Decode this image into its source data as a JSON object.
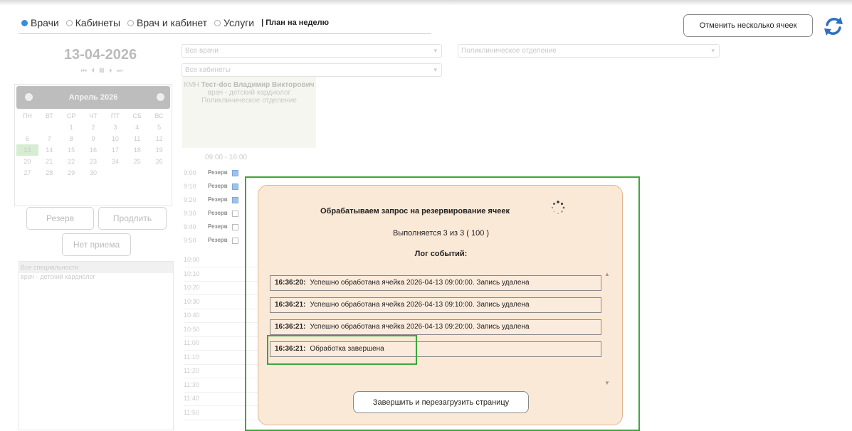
{
  "header": {
    "radio_options": [
      {
        "label": "Врачи",
        "selected": true
      },
      {
        "label": "Кабинеты",
        "selected": false
      },
      {
        "label": "Врач и кабинет",
        "selected": false
      },
      {
        "label": "Услуги",
        "selected": false
      }
    ],
    "plan_label": "| План на неделю",
    "cancel_button": "Отменить несколько ячеек",
    "refresh_icon": "refresh-icon"
  },
  "left": {
    "date": "13-04-2026",
    "nav": "⏮ ⏴ ▦ ⏵ ⏭",
    "calendar": {
      "month": "Апрель 2026",
      "weekdays": [
        "ПН",
        "ВТ",
        "СР",
        "ЧТ",
        "ПТ",
        "СБ",
        "ВС"
      ],
      "days": [
        "",
        "",
        "1",
        "2",
        "3",
        "4",
        "5",
        "6",
        "7",
        "8",
        "9",
        "10",
        "11",
        "12",
        "13",
        "14",
        "15",
        "16",
        "17",
        "18",
        "19",
        "20",
        "21",
        "22",
        "23",
        "24",
        "25",
        "26",
        "27",
        "28",
        "29",
        "30",
        "",
        "",
        ""
      ],
      "today": "13"
    },
    "buttons": {
      "reserve": "Резерв",
      "extend": "Продлить",
      "no_reception": "Нет приема"
    },
    "specialties": [
      "Все специальности",
      "врач - детский кардиолог"
    ]
  },
  "filters": {
    "doctors": "Все врачи",
    "rooms": "Все кабинеты",
    "department": "Поликлиническое отделение"
  },
  "doctor": {
    "code": "КМН",
    "name": "Тест-doc Владимир Викторович",
    "role": "врач - детский кардиолог",
    "department": "Поликлиническое отделение",
    "hours": "09:00 - 16:00"
  },
  "slots": [
    {
      "time": "9:00",
      "label": "Резерв",
      "checked": true
    },
    {
      "time": "9:10",
      "label": "Резерв",
      "checked": true
    },
    {
      "time": "9:20",
      "label": "Резерв",
      "checked": true
    },
    {
      "time": "9:30",
      "label": "Резерв",
      "checked": false
    },
    {
      "time": "9:40",
      "label": "Резерв",
      "checked": false
    },
    {
      "time": "9:50",
      "label": "Резерв",
      "checked": false
    }
  ],
  "empty_times": [
    "10:00",
    "10:10",
    "10:20",
    "10:30",
    "10:40",
    "10:50",
    "11:00",
    "11:10",
    "11:20",
    "11:30",
    "11:40",
    "11:50"
  ],
  "dialog": {
    "title": "Обрабатываем запрос на резервирование ячеек",
    "progress": "Выполняется 3 из 3 ( 100 )",
    "log_title": "Лог событий:",
    "log": [
      {
        "time": "16:36:20:",
        "text": "Успешно обработана ячейка 2026-04-13 09:00:00. Запись удалена"
      },
      {
        "time": "16:36:21:",
        "text": "Успешно обработана ячейка 2026-04-13 09:10:00. Запись удалена"
      },
      {
        "time": "16:36:21:",
        "text": "Успешно обработана ячейка 2026-04-13 09:20:00. Запись удалена"
      },
      {
        "time": "16:36:21:",
        "text": "Обработка завершена"
      }
    ],
    "finish_button": "Завершить и перезагрузить страницу"
  }
}
